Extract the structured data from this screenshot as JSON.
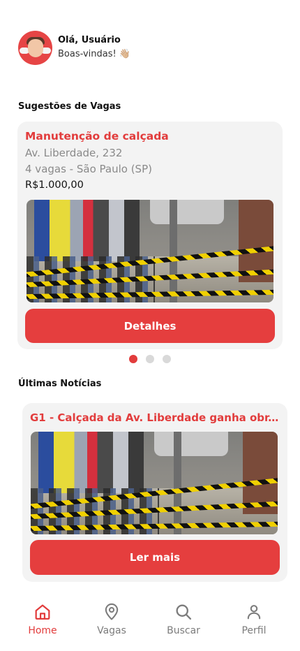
{
  "header": {
    "greeting": "Olá, Usuário",
    "welcome": "Boas-vindas! 👋🏼"
  },
  "suggestions": {
    "title": "Sugestões de Vagas",
    "job": {
      "title": "Manutenção de calçada",
      "address": "Av. Liberdade, 232",
      "vagas": "4 vagas - São Paulo (SP)",
      "price": "R$1.000,00",
      "button": "Detalhes"
    },
    "pagination": {
      "total": 3,
      "active": 1
    }
  },
  "news": {
    "title": "Últimas Notícias",
    "item": {
      "headline": "G1 - Calçada da Av. Liberdade ganha obr...",
      "button": "Ler mais"
    }
  },
  "nav": {
    "items": [
      {
        "label": "Home",
        "icon": "home-icon",
        "active": true
      },
      {
        "label": "Vagas",
        "icon": "map-pin-icon",
        "active": false
      },
      {
        "label": "Buscar",
        "icon": "search-icon",
        "active": false
      },
      {
        "label": "Perfil",
        "icon": "user-icon",
        "active": false
      }
    ]
  },
  "colors": {
    "accent": "#e53e3e",
    "card_bg": "#f3f3f3",
    "muted_text": "#8a8a8a"
  }
}
